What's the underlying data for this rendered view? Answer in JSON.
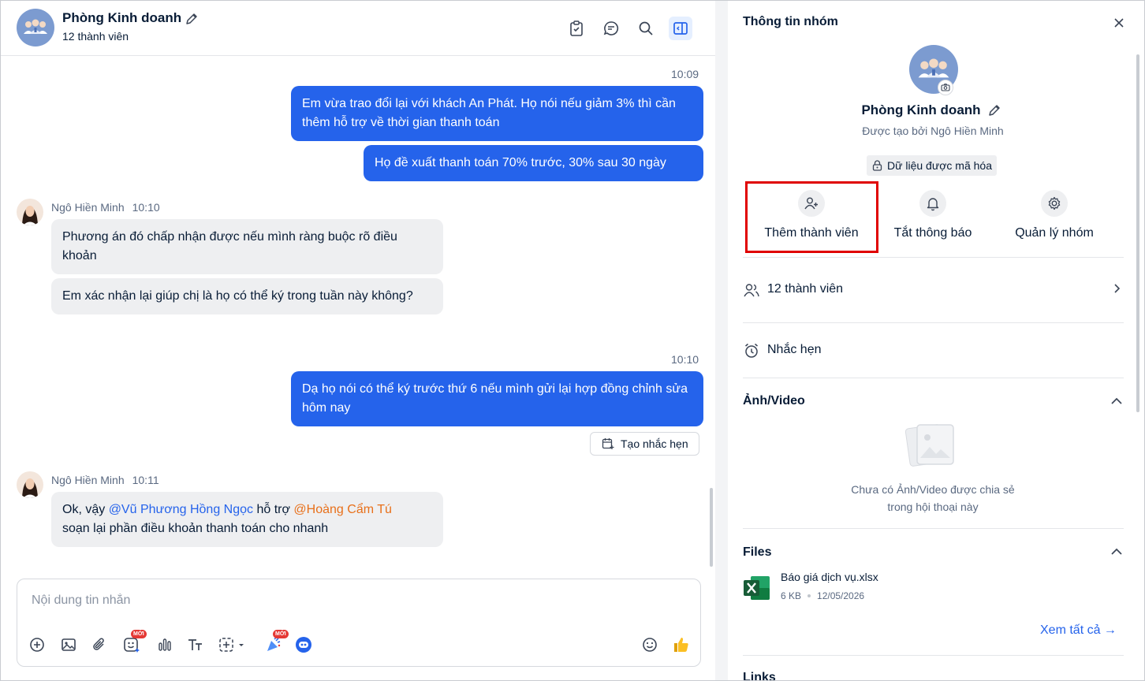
{
  "chat": {
    "title": "Phòng Kinh doanh",
    "subtitle": "12 thành viên",
    "messages": {
      "t1": "10:09",
      "out1": "Em vừa trao đổi lại với khách An Phát. Họ nói nếu giảm 3% thì cần thêm hỗ trợ về thời gian thanh toán",
      "out2": "Họ đề xuất thanh toán 70% trước, 30% sau 30 ngày",
      "sender1": "Ngô Hiền Minh",
      "sender1_time": "10:10",
      "in1": "Phương án đó chấp nhận được nếu mình ràng buộc rõ điều khoản",
      "in2": "Em xác nhận lại giúp chị là họ có thể ký trong tuần này không?",
      "t2": "10:10",
      "out3": "Dạ họ nói có thể ký trước thứ 6 nếu mình gửi lại hợp đồng chỉnh sửa hôm nay",
      "remind_label": "Tạo nhắc hẹn",
      "sender2": "Ngô Hiền Minh",
      "sender2_time": "10:11",
      "in3_a": "Ok, vậy ",
      "in3_mention1": "@Vũ Phương Hồng Ngọc",
      "in3_b": " hỗ trợ ",
      "in3_mention2": "@Hoàng Cẩm Tú",
      "in3_c": "soạn lại phần điều khoản thanh toán cho nhanh"
    },
    "composer": {
      "placeholder": "Nội dung tin nhắn",
      "badge_new": "MỚI"
    }
  },
  "info": {
    "title": "Thông tin nhóm",
    "group_name": "Phòng Kinh doanh",
    "created_by": "Được tạo bởi Ngô Hiền Minh",
    "encrypted": "Dữ liệu được mã hóa",
    "actions": {
      "add_member": "Thêm thành viên",
      "mute": "Tắt thông báo",
      "manage": "Quản lý nhóm"
    },
    "members": "12 thành viên",
    "reminder": "Nhắc hẹn",
    "media": {
      "title": "Ảnh/Video",
      "empty_line1": "Chưa có Ảnh/Video được chia sẻ",
      "empty_line2": "trong hội thoại này"
    },
    "files": {
      "title": "Files",
      "name": "Báo giá dịch vụ.xlsx",
      "size": "6 KB",
      "date": "12/05/2026",
      "see_all": "Xem tất cả →"
    },
    "links_title": "Links"
  },
  "colors": {
    "accent": "#2563eb",
    "mention_orange": "#e8701a",
    "highlight_box": "#e00000",
    "excel_green": "#1d7044"
  }
}
